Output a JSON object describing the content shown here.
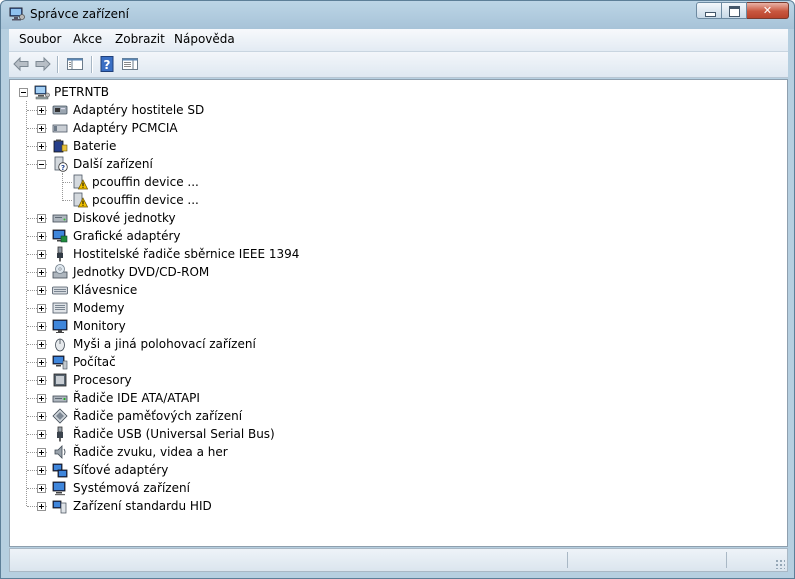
{
  "window": {
    "title": "Správce zařízení"
  },
  "menu": {
    "items": [
      "Soubor",
      "Akce",
      "Zobrazit",
      "Nápověda"
    ]
  },
  "toolbar": {
    "icons": [
      "back-arrow-icon",
      "forward-arrow-icon",
      "show-hide-tree-icon",
      "help-icon",
      "properties-icon"
    ]
  },
  "tree": {
    "root": {
      "label": "PETRNTB",
      "icon": "computer-icon",
      "expanded": true
    },
    "categories": [
      {
        "label": "Adaptéry hostitele SD",
        "icon": "sd-adapter-icon",
        "expanded": false
      },
      {
        "label": "Adaptéry PCMCIA",
        "icon": "pcmcia-icon",
        "expanded": false
      },
      {
        "label": "Baterie",
        "icon": "battery-icon",
        "expanded": false
      },
      {
        "label": "Další zařízení",
        "icon": "unknown-device-icon",
        "expanded": true,
        "children": [
          {
            "label": "pcouffin device ...",
            "icon": "warning-device-icon"
          },
          {
            "label": "pcouffin device ...",
            "icon": "warning-device-icon"
          }
        ]
      },
      {
        "label": "Diskové jednotky",
        "icon": "disk-drive-icon",
        "expanded": false
      },
      {
        "label": "Grafické adaptéry",
        "icon": "display-adapter-icon",
        "expanded": false
      },
      {
        "label": "Hostitelské řadiče sběrnice IEEE 1394",
        "icon": "ieee1394-icon",
        "expanded": false
      },
      {
        "label": "Jednotky DVD/CD-ROM",
        "icon": "dvd-drive-icon",
        "expanded": false
      },
      {
        "label": "Klávesnice",
        "icon": "keyboard-icon",
        "expanded": false
      },
      {
        "label": "Modemy",
        "icon": "modem-icon",
        "expanded": false
      },
      {
        "label": "Monitory",
        "icon": "monitor-icon",
        "expanded": false
      },
      {
        "label": "Myši a jiná polohovací zařízení",
        "icon": "mouse-icon",
        "expanded": false
      },
      {
        "label": "Počítač",
        "icon": "pc-icon",
        "expanded": false
      },
      {
        "label": "Procesory",
        "icon": "processor-icon",
        "expanded": false
      },
      {
        "label": "Řadiče IDE ATA/ATAPI",
        "icon": "ide-controller-icon",
        "expanded": false
      },
      {
        "label": "Řadiče paměťových zařízení",
        "icon": "storage-controller-icon",
        "expanded": false
      },
      {
        "label": "Řadiče USB (Universal Serial Bus)",
        "icon": "usb-icon",
        "expanded": false
      },
      {
        "label": "Řadiče zvuku, videa a her",
        "icon": "sound-icon",
        "expanded": false
      },
      {
        "label": "Síťové adaptéry",
        "icon": "network-adapter-icon",
        "expanded": false
      },
      {
        "label": "Systémová zařízení",
        "icon": "system-device-icon",
        "expanded": false
      },
      {
        "label": "Zařízení standardu HID",
        "icon": "hid-icon",
        "expanded": false
      }
    ]
  },
  "statusbar": {
    "text": ""
  }
}
